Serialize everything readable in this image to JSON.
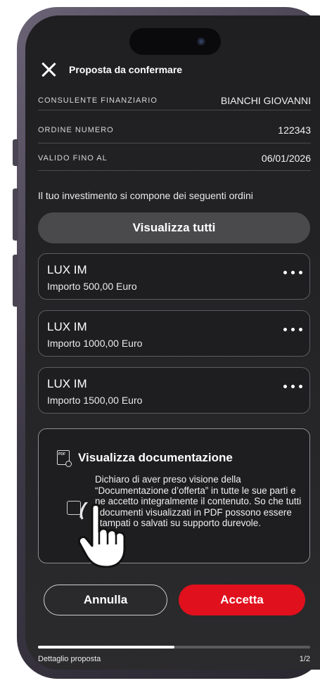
{
  "header": {
    "title": "Proposta da confermare"
  },
  "info": [
    {
      "label": "CONSULENTE FINANZIARIO",
      "value": "BIANCHI GIOVANNI"
    },
    {
      "label": "ORDINE NUMERO",
      "value": "122343"
    },
    {
      "label": "VALIDO FINO AL",
      "value": "06/01/2026"
    }
  ],
  "intro": "Il tuo investimento si compone dei seguenti ordini",
  "view_all_label": "Visualizza tutti",
  "orders": [
    {
      "name": "LUX IM",
      "amount": "Importo 500,00 Euro"
    },
    {
      "name": "LUX IM",
      "amount": "Importo 1000,00 Euro"
    },
    {
      "name": "LUX IM",
      "amount": "Importo 1500,00 Euro"
    }
  ],
  "documentation": {
    "title": "Visualizza documentazione",
    "pdf_icon_text": "PDF",
    "declaration": "Dichiaro di aver preso visione della “Documentazione d’offerta” in tutte le sue parti e ne accetto integralmente il contenuto. So che tutti i documenti visualizzati in PDF possono essere stampati o salvati su supporto durevole."
  },
  "actions": {
    "cancel": "Annulla",
    "accept": "Accetta"
  },
  "footer": {
    "label": "Dettaglio proposta",
    "page": "1/2",
    "progress": 0.5
  },
  "colors": {
    "accent": "#e0101d",
    "background": "#232325"
  },
  "icons": {
    "close": "close-icon",
    "more": "more-dots-icon",
    "pdf": "pdf-icon",
    "pointer": "hand-pointer-icon"
  }
}
